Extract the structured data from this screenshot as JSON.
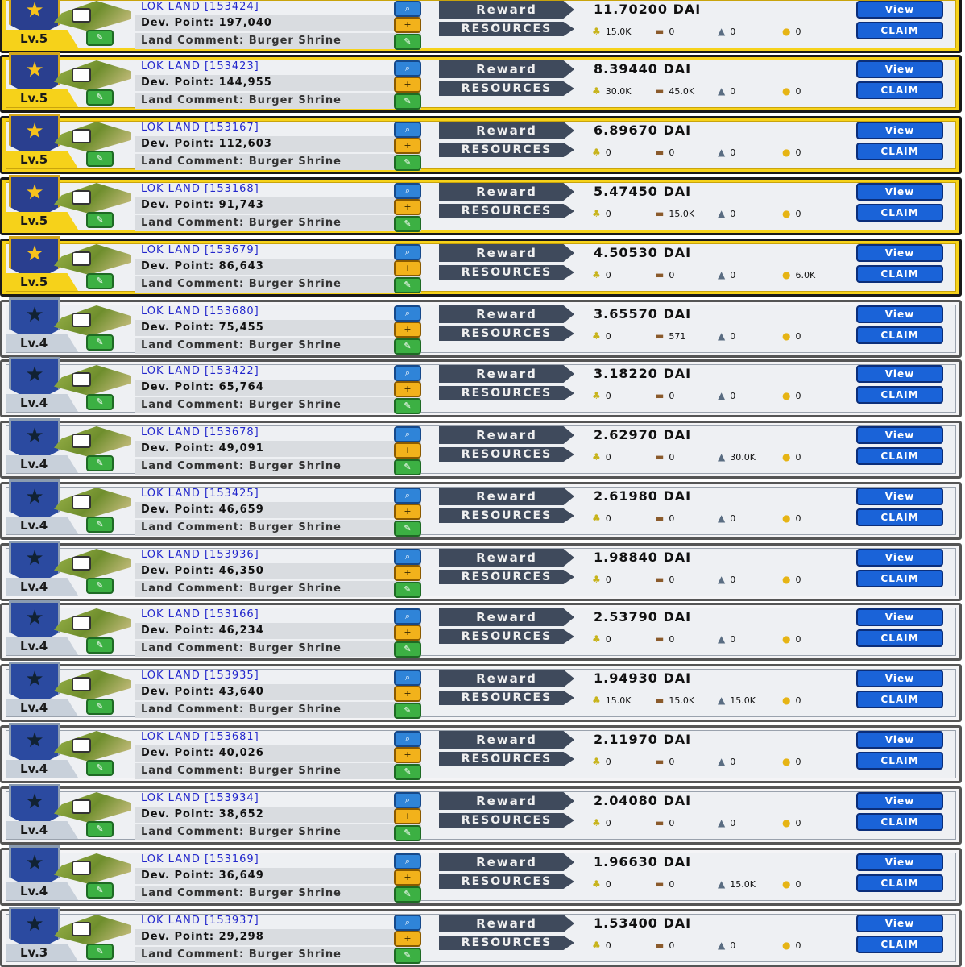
{
  "labels": {
    "reward": "Reward",
    "resources": "RESOURCES",
    "view_button": "View",
    "claim_button": "CLAIM"
  },
  "icons": {
    "badge": "star-icon",
    "land": "land-plot-icon",
    "search": "search-icon",
    "plus": "plus-icon",
    "edit": "edit-icon",
    "food": "corn-icon",
    "wood": "wood-icon",
    "stone": "stone-icon",
    "gold": "gold-icon"
  },
  "colors": {
    "tier_gold": "#f6d21a",
    "tier_gray": "#c8d0da",
    "button_blue": "#1a63d8",
    "label_dark": "#3f4a5c",
    "title_blue": "#2226cc"
  },
  "lands": [
    {
      "tier": "gold",
      "level": "Lv.5",
      "title": "LOK LAND [153424]",
      "dev": "Dev. Point: 197,040",
      "comment": "Land Comment: Burger Shrine",
      "reward": "11.70200 DAI",
      "food": "15.0K",
      "wood": "0",
      "stone": "0",
      "gold": "0"
    },
    {
      "tier": "gold",
      "level": "Lv.5",
      "title": "LOK LAND [153423]",
      "dev": "Dev. Point: 144,955",
      "comment": "Land Comment: Burger Shrine",
      "reward": "8.39440 DAI",
      "food": "30.0K",
      "wood": "45.0K",
      "stone": "0",
      "gold": "0"
    },
    {
      "tier": "gold",
      "level": "Lv.5",
      "title": "LOK LAND [153167]",
      "dev": "Dev. Point: 112,603",
      "comment": "Land Comment: Burger Shrine",
      "reward": "6.89670 DAI",
      "food": "0",
      "wood": "0",
      "stone": "0",
      "gold": "0"
    },
    {
      "tier": "gold",
      "level": "Lv.5",
      "title": "LOK LAND [153168]",
      "dev": "Dev. Point: 91,743",
      "comment": "Land Comment: Burger Shrine",
      "reward": "5.47450 DAI",
      "food": "0",
      "wood": "15.0K",
      "stone": "0",
      "gold": "0"
    },
    {
      "tier": "gold",
      "level": "Lv.5",
      "title": "LOK LAND [153679]",
      "dev": "Dev. Point: 86,643",
      "comment": "Land Comment: Burger Shrine",
      "reward": "4.50530 DAI",
      "food": "0",
      "wood": "0",
      "stone": "0",
      "gold": "6.0K"
    },
    {
      "tier": "gray",
      "level": "Lv.4",
      "title": "LOK LAND [153680]",
      "dev": "Dev. Point: 75,455",
      "comment": "Land Comment: Burger Shrine",
      "reward": "3.65570 DAI",
      "food": "0",
      "wood": "571",
      "stone": "0",
      "gold": "0"
    },
    {
      "tier": "gray",
      "level": "Lv.4",
      "title": "LOK LAND [153422]",
      "dev": "Dev. Point: 65,764",
      "comment": "Land Comment: Burger Shrine",
      "reward": "3.18220 DAI",
      "food": "0",
      "wood": "0",
      "stone": "0",
      "gold": "0"
    },
    {
      "tier": "gray",
      "level": "Lv.4",
      "title": "LOK LAND [153678]",
      "dev": "Dev. Point: 49,091",
      "comment": "Land Comment: Burger Shrine",
      "reward": "2.62970 DAI",
      "food": "0",
      "wood": "0",
      "stone": "30.0K",
      "gold": "0"
    },
    {
      "tier": "gray",
      "level": "Lv.4",
      "title": "LOK LAND [153425]",
      "dev": "Dev. Point: 46,659",
      "comment": "Land Comment: Burger Shrine",
      "reward": "2.61980 DAI",
      "food": "0",
      "wood": "0",
      "stone": "0",
      "gold": "0"
    },
    {
      "tier": "gray",
      "level": "Lv.4",
      "title": "LOK LAND [153936]",
      "dev": "Dev. Point: 46,350",
      "comment": "Land Comment: Burger Shrine",
      "reward": "1.98840 DAI",
      "food": "0",
      "wood": "0",
      "stone": "0",
      "gold": "0"
    },
    {
      "tier": "gray",
      "level": "Lv.4",
      "title": "LOK LAND [153166]",
      "dev": "Dev. Point: 46,234",
      "comment": "Land Comment: Burger Shrine",
      "reward": "2.53790 DAI",
      "food": "0",
      "wood": "0",
      "stone": "0",
      "gold": "0"
    },
    {
      "tier": "gray",
      "level": "Lv.4",
      "title": "LOK LAND [153935]",
      "dev": "Dev. Point: 43,640",
      "comment": "Land Comment: Burger Shrine",
      "reward": "1.94930 DAI",
      "food": "15.0K",
      "wood": "15.0K",
      "stone": "15.0K",
      "gold": "0"
    },
    {
      "tier": "gray",
      "level": "Lv.4",
      "title": "LOK LAND [153681]",
      "dev": "Dev. Point: 40,026",
      "comment": "Land Comment: Burger Shrine",
      "reward": "2.11970 DAI",
      "food": "0",
      "wood": "0",
      "stone": "0",
      "gold": "0"
    },
    {
      "tier": "gray",
      "level": "Lv.4",
      "title": "LOK LAND [153934]",
      "dev": "Dev. Point: 38,652",
      "comment": "Land Comment: Burger Shrine",
      "reward": "2.04080 DAI",
      "food": "0",
      "wood": "0",
      "stone": "0",
      "gold": "0"
    },
    {
      "tier": "gray",
      "level": "Lv.4",
      "title": "LOK LAND [153169]",
      "dev": "Dev. Point: 36,649",
      "comment": "Land Comment: Burger Shrine",
      "reward": "1.96630 DAI",
      "food": "0",
      "wood": "0",
      "stone": "15.0K",
      "gold": "0"
    },
    {
      "tier": "gray",
      "level": "Lv.3",
      "title": "LOK LAND [153937]",
      "dev": "Dev. Point: 29,298",
      "comment": "Land Comment: Burger Shrine",
      "reward": "1.53400 DAI",
      "food": "0",
      "wood": "0",
      "stone": "0",
      "gold": "0"
    }
  ]
}
